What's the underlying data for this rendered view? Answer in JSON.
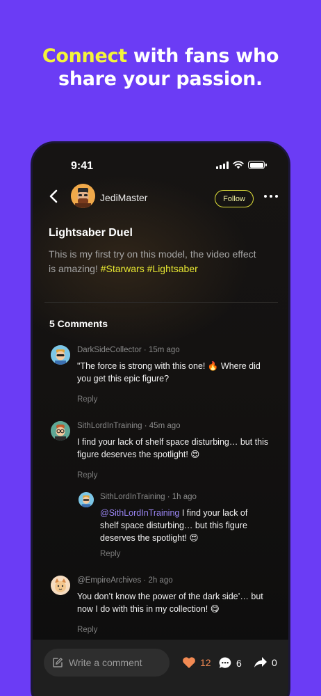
{
  "headline": {
    "highlight": "Connect",
    "rest_line1": " with fans who",
    "line2": "share your passion."
  },
  "status_bar": {
    "time": "9:41"
  },
  "post": {
    "author": "JediMaster",
    "follow_label": "Follow",
    "title": "Lightsaber Duel",
    "body": "This is my first try on  this model, the video effect is amazing!",
    "tags": [
      "#Starwars",
      "#Lightsaber"
    ]
  },
  "comments_header": "5 Comments",
  "comments": [
    {
      "user": "DarkSideCollector",
      "time": "15m ago",
      "text": "\"The force is strong with this one! 🔥 Where did you get this epic figure?",
      "reply_label": "Reply"
    },
    {
      "user": "SithLordInTraining",
      "time": "45m ago",
      "text": "I find your lack of shelf space disturbing… but this figure deserves the spotlight! 😍",
      "reply_label": "Reply"
    },
    {
      "user": "SithLordInTraining",
      "time": "1h ago",
      "mention": "@SithLordInTraining",
      "text": " I find your lack of shelf space disturbing… but this figure deserves the spotlight! 😍",
      "reply_label": "Reply"
    },
    {
      "user": "@EmpireArchives",
      "time": "2h ago",
      "text": "You don’t know the power of the dark side’… but now I do with this in my collection! 😋",
      "reply_label": "Reply"
    }
  ],
  "bottom_bar": {
    "input_placeholder": "Write a comment",
    "likes": "12",
    "comments": "6",
    "shares": "0",
    "like_color": "#f28a53"
  },
  "colors": {
    "background": "#6b3cf5",
    "accent_yellow": "#f4f43a",
    "mention": "#9b86f5"
  }
}
